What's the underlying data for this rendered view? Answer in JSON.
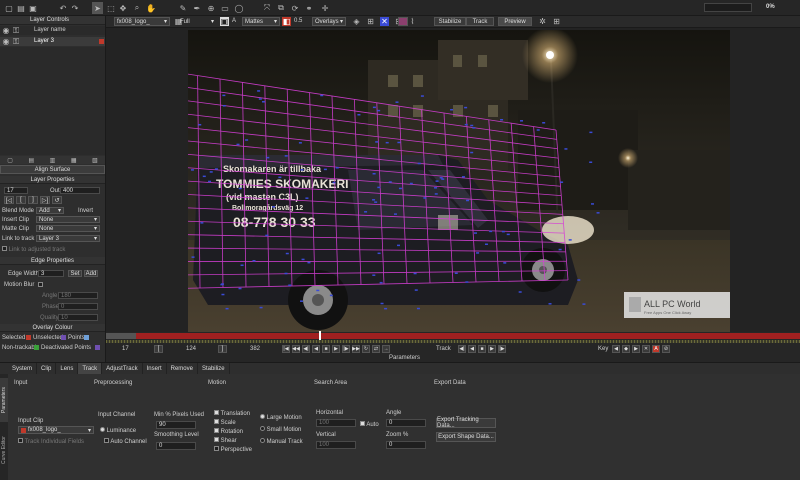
{
  "colors": {
    "accent": "#7a5fa8",
    "record": "#c0392b",
    "grid": "#d63fd6",
    "tracker": "#3a4bd6",
    "selected_color": "#c0392b",
    "unselected_color": "#6f4fb0",
    "deactivated_color": "#3aa03a",
    "points_color": "#6fa0d8"
  },
  "toolbar": {
    "progress": "0%",
    "progress_value": 0
  },
  "viewer_bar": {
    "clip": "fx008_logo_",
    "zoom": "Full",
    "mattes": "Mattes",
    "opacity": "0.5",
    "overlays": "Overlays",
    "stabilize": "Stabilize",
    "track": "Track",
    "preview": "Preview"
  },
  "layer_controls": {
    "title": "Layer Controls",
    "column_name": "Layer name",
    "layers": [
      {
        "name": "Layer 3"
      }
    ]
  },
  "align_surface": "Align Surface",
  "layer_properties": {
    "title": "Layer Properties",
    "in_value": "17",
    "out_label": "Out",
    "out_value": "400",
    "blend_mode_label": "Blend Mode",
    "blend_mode": "Add",
    "invert": "Invert",
    "insert_clip_label": "Insert Clip",
    "insert_clip": "None",
    "matte_clip_label": "Matte Clip",
    "matte_clip": "None",
    "link_to_track_label": "Link to track",
    "link_to_track": "Layer 3",
    "link_adjusted": "Link to adjusted track"
  },
  "edge_properties": {
    "title": "Edge Properties",
    "edge_width_label": "Edge Width",
    "edge_width": "3",
    "set": "Set",
    "add": "Add",
    "motion_blur_label": "Motion Blur",
    "angle_label": "Angle",
    "angle": "180",
    "phase_label": "Phase",
    "phase": "0",
    "quality_label": "Quality",
    "quality": "10"
  },
  "overlay_colour": {
    "title": "Overlay Colour",
    "selected": "Selected",
    "unselected": "Unselected",
    "points": "Points",
    "non_trackable": "Non-trackable",
    "deactivated_points": "Deactivated Points"
  },
  "scene": {
    "sign_line1": "Skomakaren är tillbaka",
    "sign_line2": "TOMMIES SKOMAKERI",
    "sign_line3": "(vid masten C3L)",
    "sign_line4": "Bollmoragårdsväg 12",
    "sign_line5": "08-778 30 33",
    "watermark": "ALL PC World",
    "watermark_sub": "Free Apps One Click Away"
  },
  "timeline": {
    "start": "17",
    "current": "124",
    "end": "382",
    "track_label": "Track",
    "key_label": "Key",
    "parameters_label": "Parameters"
  },
  "tabs": [
    "System",
    "Clip",
    "Lens",
    "Track",
    "AdjustTrack",
    "Insert",
    "Remove",
    "Stabilize"
  ],
  "active_tab": "Track",
  "side_tabs": [
    "Parameters",
    "Curve Editor"
  ],
  "params": {
    "input_title": "Input",
    "input_clip_label": "Input Clip",
    "input_clip": "fx008_logo_",
    "track_individual": "Track Individual Fields",
    "preprocessing_title": "Preprocessing",
    "input_channel_label": "Input Channel",
    "luminance": "Luminance",
    "auto_channel": "Auto Channel",
    "min_pixels_label": "Min % Pixels Used",
    "min_pixels": "90",
    "smoothing_label": "Smoothing Level",
    "smoothing": "0",
    "motion_title": "Motion",
    "translation": "Translation",
    "scale": "Scale",
    "rotation": "Rotation",
    "shear": "Shear",
    "perspective": "Perspective",
    "large_motion": "Large Motion",
    "small_motion": "Small Motion",
    "manual_track": "Manual Track",
    "search_area_title": "Search Area",
    "horizontal_label": "Horizontal",
    "horizontal": "100",
    "vertical_label": "Vertical",
    "vertical": "100",
    "angle_label": "Angle",
    "angle": "0",
    "zoom_label": "Zoom %",
    "zoom": "0",
    "auto": "Auto",
    "export_title": "Export Data",
    "export_tracking": "Export Tracking Data...",
    "export_shape": "Export Shape Data..."
  }
}
